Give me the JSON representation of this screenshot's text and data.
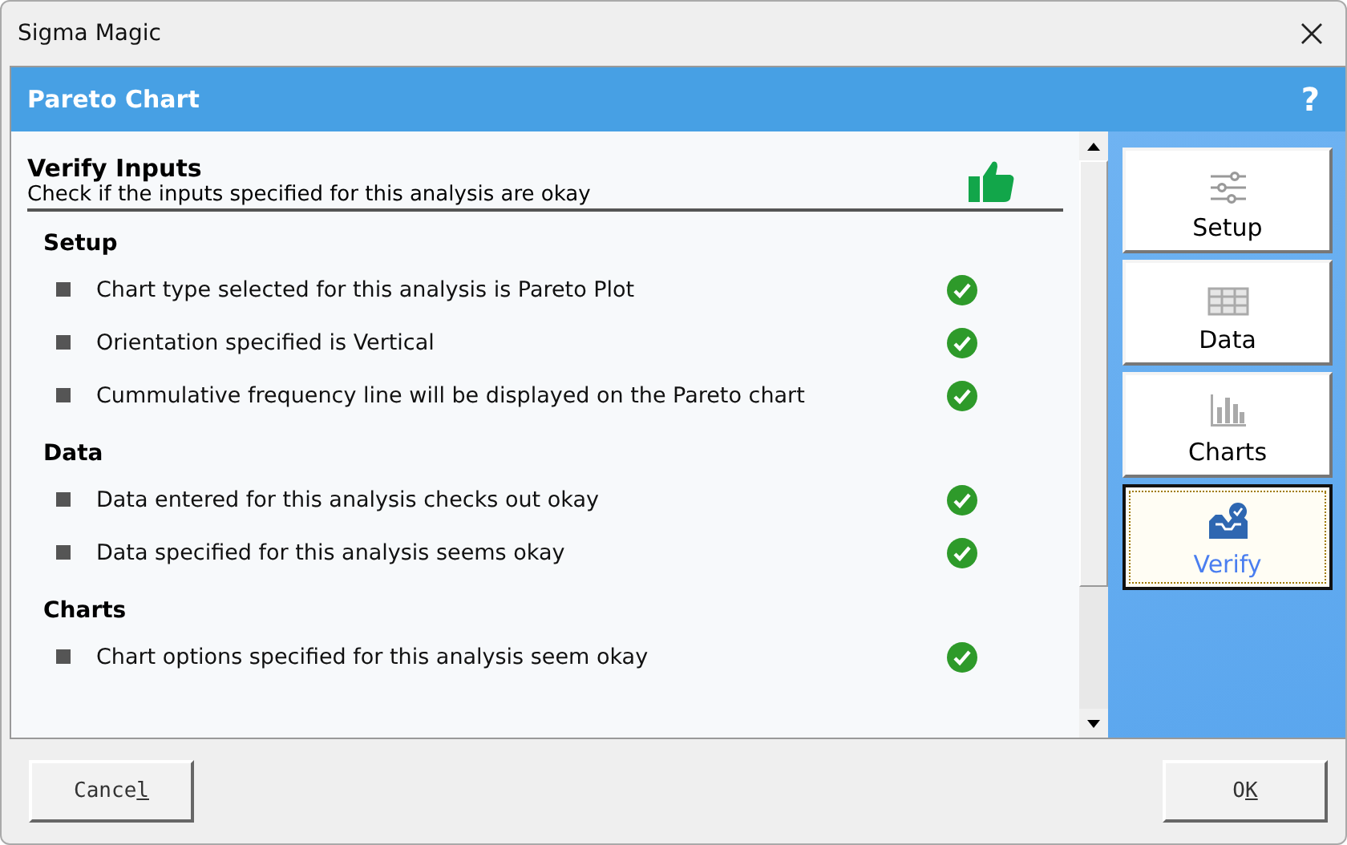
{
  "window": {
    "title": "Sigma Magic"
  },
  "header": {
    "title": "Pareto Chart",
    "help": "?"
  },
  "panel": {
    "title": "Verify Inputs",
    "subtitle": "Check if the inputs specified for this analysis are okay"
  },
  "sections": [
    {
      "title": "Setup",
      "items": [
        {
          "text": "Chart type selected for this analysis is Pareto Plot",
          "ok": true
        },
        {
          "text": "Orientation specified is Vertical",
          "ok": true
        },
        {
          "text": "Cummulative frequency line will be displayed on the Pareto chart",
          "ok": true
        }
      ]
    },
    {
      "title": "Data",
      "items": [
        {
          "text": "Data entered for this analysis checks out okay",
          "ok": true
        },
        {
          "text": "Data specified for this analysis seems okay",
          "ok": true
        }
      ]
    },
    {
      "title": "Charts",
      "items": [
        {
          "text": "Chart options specified for this analysis seem okay",
          "ok": true
        }
      ]
    }
  ],
  "nav": [
    {
      "label": "Setup",
      "kind": "sliders",
      "selected": false
    },
    {
      "label": "Data",
      "kind": "table",
      "selected": false
    },
    {
      "label": "Charts",
      "kind": "bars",
      "selected": false
    },
    {
      "label": "Verify",
      "kind": "inbox",
      "selected": true
    }
  ],
  "buttons": [
    {
      "before": "Cance",
      "accelerator": "l"
    },
    {
      "before": "O",
      "accelerator": "K"
    }
  ]
}
